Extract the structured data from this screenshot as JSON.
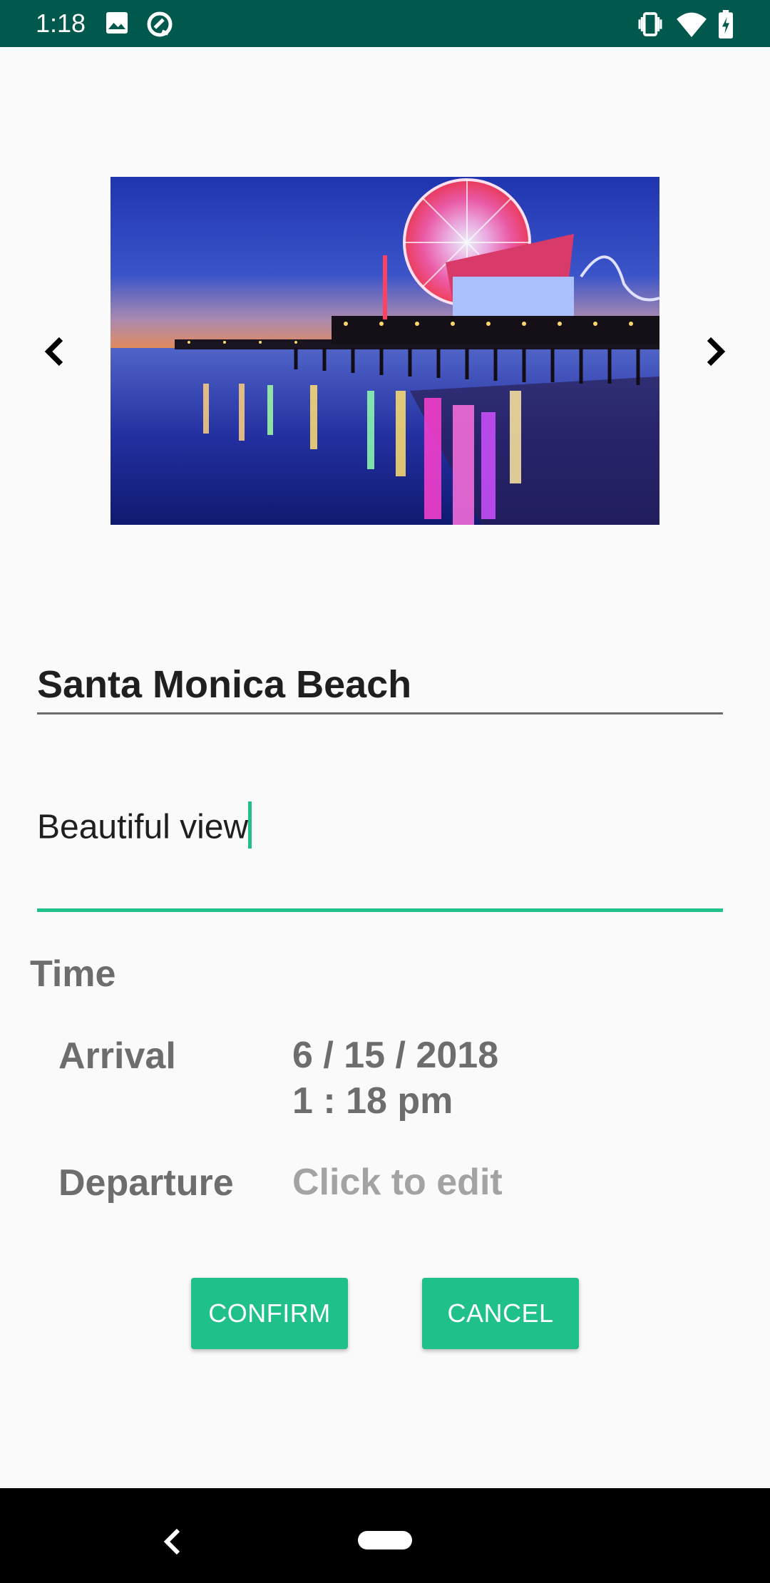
{
  "status_bar": {
    "time": "1:18",
    "icons_left": [
      "image-icon",
      "assistant-icon"
    ],
    "icons_right": [
      "vibrate-icon",
      "wifi-icon",
      "battery-charging-icon"
    ]
  },
  "carousel": {
    "prev_icon": "chevron-left-icon",
    "next_icon": "chevron-right-icon",
    "image_description": "Santa Monica pier with lit ferris wheel at dusk"
  },
  "form": {
    "title_value": "Santa Monica Beach",
    "description_value": "Beautiful view",
    "time_section_label": "Time",
    "arrival_label": "Arrival",
    "arrival_date": "6 / 15 / 2018",
    "arrival_time": "1 : 18 pm",
    "departure_label": "Departure",
    "departure_value": "Click to edit"
  },
  "buttons": {
    "confirm_label": "CONFIRM",
    "cancel_label": "CANCEL"
  },
  "colors": {
    "status_bar": "#00594c",
    "accent": "#1fc08a",
    "background": "#fafafa"
  },
  "nav_bar": {
    "back_icon": "back-icon",
    "home_icon": "home-pill-icon"
  }
}
